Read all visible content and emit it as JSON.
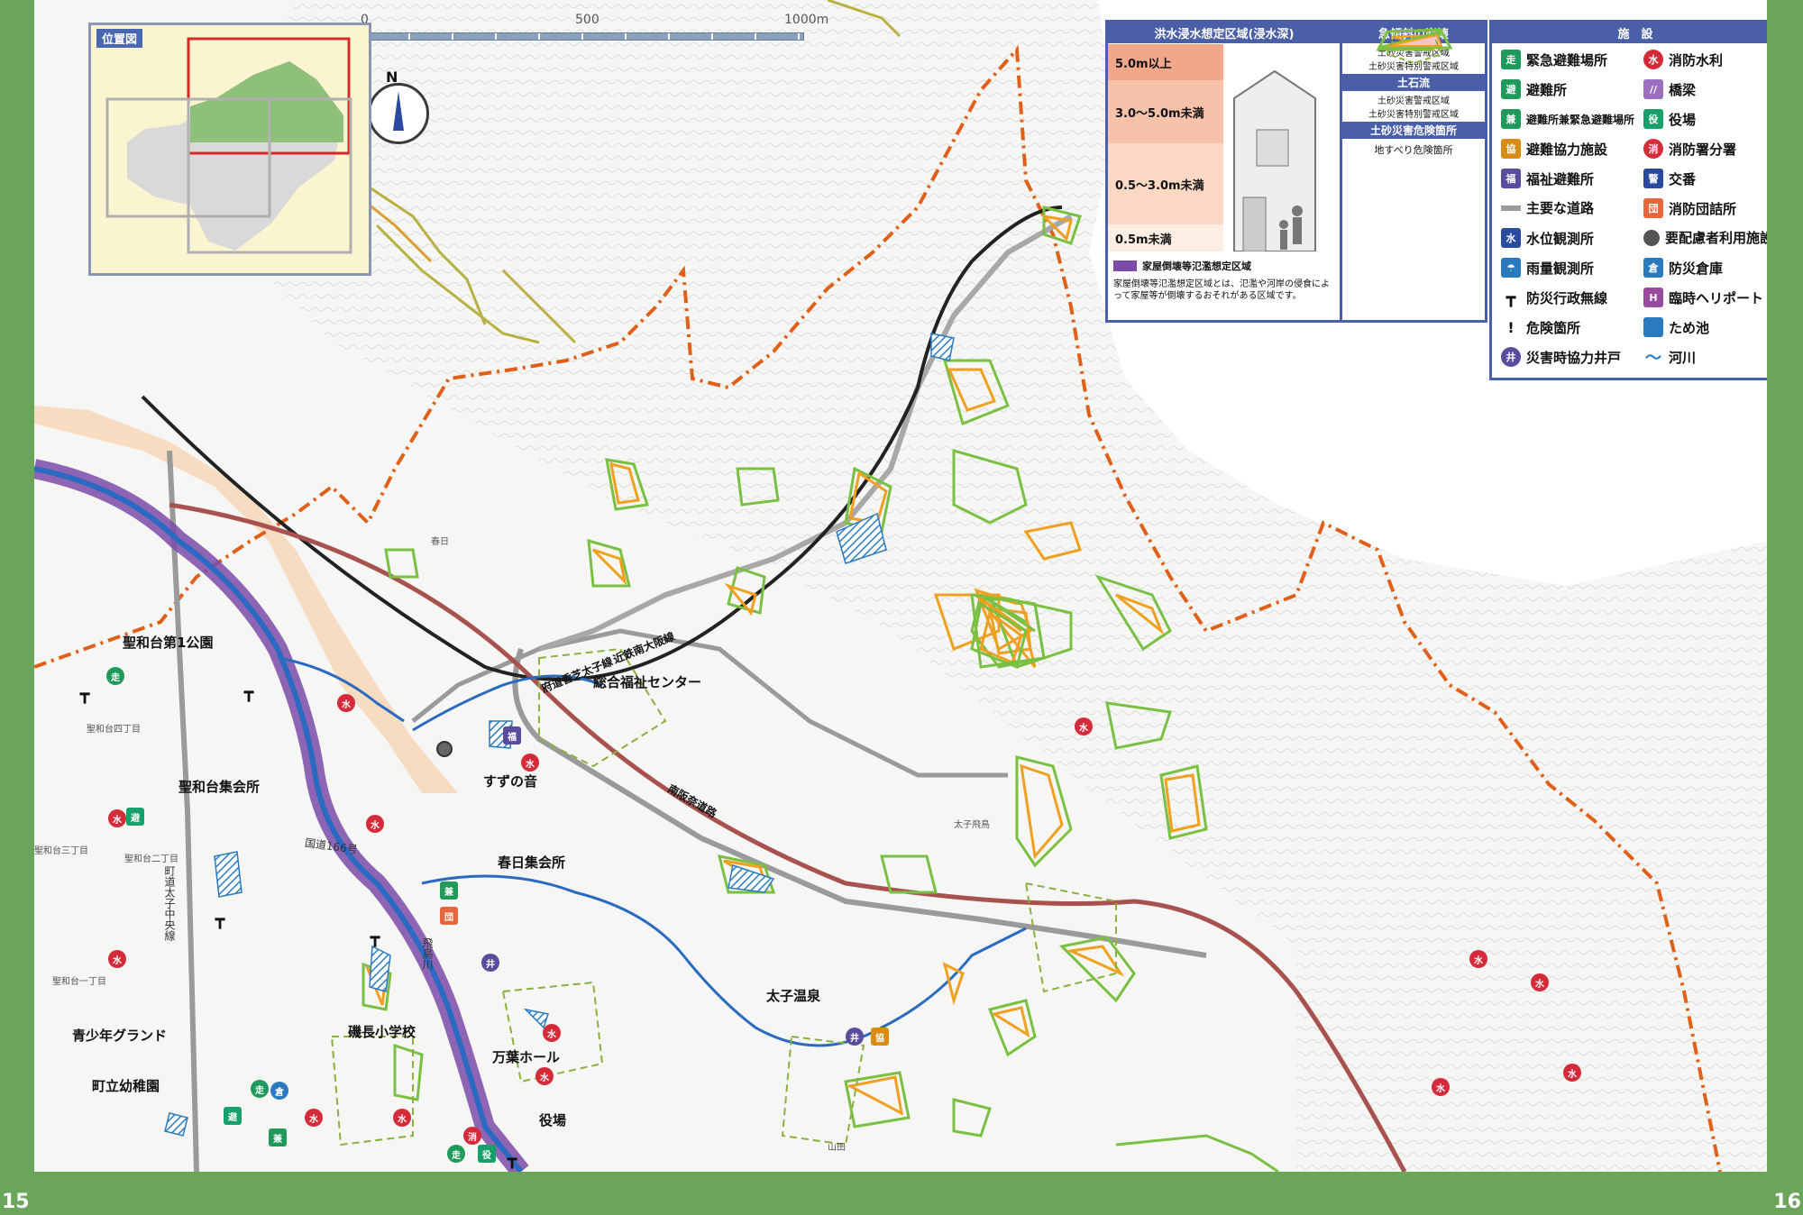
{
  "page_numbers": {
    "left": "15",
    "right": "16"
  },
  "inset": {
    "title": "位置図"
  },
  "scale": {
    "zero": "0",
    "mid": "500",
    "end": "1000m"
  },
  "north": "N",
  "flood_legend": {
    "title": "洪水浸水想定区域(浸水深)",
    "levels": [
      "5.0m以上",
      "3.0〜5.0m未満",
      "0.5〜3.0m未満",
      "0.5m未満"
    ],
    "colors": [
      "#f1a78a",
      "#f6c2aa",
      "#fad8c4",
      "#fdeee3"
    ],
    "collapse_label": "家屋倒壊等氾濫想定区域",
    "collapse_note": "家屋倒壊等氾濫想定区域とは、氾濫や河岸の侵食によって家屋等が倒壊するおそれがある区域です。"
  },
  "slope_legend": {
    "title": "急傾斜の崩壊",
    "warn": "土砂災害警戒区域",
    "special": "土砂災害特別警戒区域",
    "debris_title": "土石流",
    "debris_warn": "土砂災害警戒区域",
    "debris_special": "土砂災害特別警戒区域",
    "danger_title": "土砂災害危険箇所",
    "landslide": "地すべり危険箇所"
  },
  "facility_legend": {
    "title": "施　設",
    "left": [
      {
        "label": "緊急避難場所",
        "icon": "emergency-evacuation-icon",
        "glyph": "走",
        "color": "#1f9a5a"
      },
      {
        "label": "避難所",
        "icon": "shelter-icon",
        "glyph": "避",
        "color": "#1f9a5a"
      },
      {
        "label": "避難所兼緊急避難場所",
        "icon": "shelter-emergency-icon",
        "glyph": "兼",
        "color": "#1f9a5a"
      },
      {
        "label": "避難協力施設",
        "icon": "cooperation-facility-icon",
        "glyph": "協",
        "color": "#d98c14"
      },
      {
        "label": "福祉避難所",
        "icon": "welfare-shelter-icon",
        "glyph": "福",
        "color": "#5b4b9e"
      },
      {
        "label": "主要な道路",
        "icon": "main-road-icon",
        "glyph": "",
        "color": "#9a9a9a"
      },
      {
        "label": "水位観測所",
        "icon": "water-level-station-icon",
        "glyph": "水",
        "color": "#2a4aa0"
      },
      {
        "label": "雨量観測所",
        "icon": "rain-gauge-icon",
        "glyph": "☂",
        "color": "#2a7ac0"
      },
      {
        "label": "防災行政無線",
        "icon": "radio-tower-icon",
        "glyph": "┳",
        "color": "#111111"
      },
      {
        "label": "危険箇所",
        "icon": "danger-icon",
        "glyph": "!",
        "color": "#e8c21a"
      },
      {
        "label": "災害時協力井戸",
        "icon": "well-icon",
        "glyph": "井",
        "color": "#5b4b9e"
      }
    ],
    "right": [
      {
        "label": "消防水利",
        "icon": "fire-water-icon",
        "glyph": "水",
        "color": "#d42a3a"
      },
      {
        "label": "橋梁",
        "icon": "bridge-icon",
        "glyph": "//",
        "color": "#9a6fbf"
      },
      {
        "label": "役場",
        "icon": "town-office-icon",
        "glyph": "役",
        "color": "#18a06a"
      },
      {
        "label": "消防署分署",
        "icon": "fire-station-icon",
        "glyph": "消",
        "color": "#d42a3a"
      },
      {
        "label": "交番",
        "icon": "police-box-icon",
        "glyph": "警",
        "color": "#2a4aa0"
      },
      {
        "label": "消防団詰所",
        "icon": "fire-brigade-icon",
        "glyph": "団",
        "color": "#e8663d"
      },
      {
        "label": "要配慮者利用施設",
        "icon": "care-facility-icon",
        "glyph": "",
        "color": "#555555"
      },
      {
        "label": "防災倉庫",
        "icon": "storage-icon",
        "glyph": "倉",
        "color": "#2a7ac0"
      },
      {
        "label": "臨時ヘリポート",
        "icon": "heliport-icon",
        "glyph": "H",
        "color": "#9a4a9e"
      },
      {
        "label": "ため池",
        "icon": "pond-icon",
        "glyph": "",
        "color": "#2a7ac0"
      },
      {
        "label": "河川",
        "icon": "river-icon",
        "glyph": "",
        "color": "#2a7ac0"
      }
    ]
  },
  "map_labels": {
    "park1": "聖和台第1公園",
    "seiwa_hall": "聖和台集会所",
    "welfare_center": "総合福祉センター",
    "suzunone": "すずの音",
    "kasuga_hall": "春日集会所",
    "taishi_onsen": "太子温泉",
    "youth_ground": "青少年グランド",
    "iwanaga_school": "磯長小学校",
    "manyo_hall": "万葉ホール",
    "town_kindergarten": "町立幼稚園",
    "town_office": "役場",
    "kintetsu": "近鉄南大阪線",
    "prefroad": "府道香芝太子線",
    "minami_hanna": "南阪奈道路",
    "national_route": "国道166号",
    "taishi_line": "町道太子中央線",
    "asuka_river": "飛鳥川",
    "kasuga": "春日",
    "taishi_asuka": "太子飛鳥",
    "seiwa_1": "聖和台四丁目",
    "seiwa_2": "聖和台三丁目",
    "seiwa_3": "聖和台二丁目",
    "seiwa_4": "聖和台一丁目",
    "yamada": "山田"
  }
}
